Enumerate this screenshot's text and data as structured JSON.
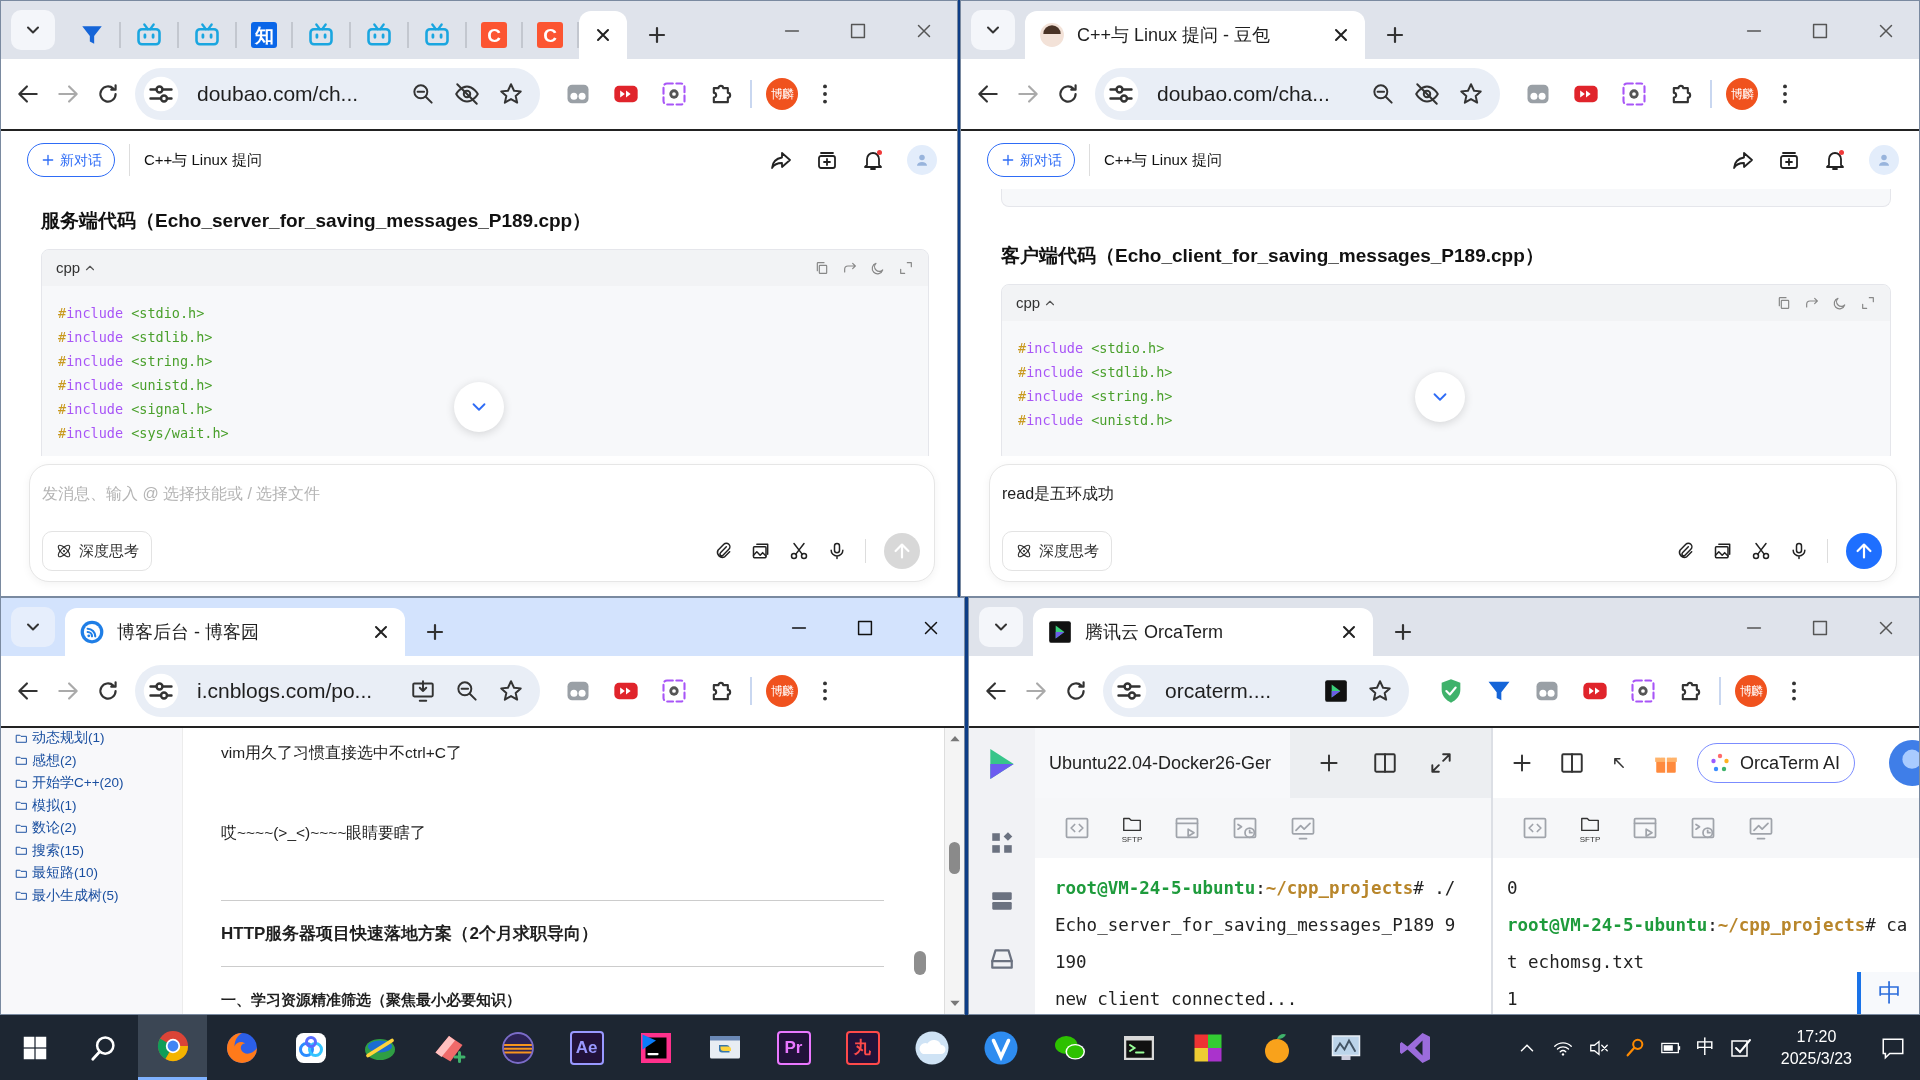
{
  "windows": [
    {
      "kind": "chat",
      "focused": false,
      "tabs": [
        {
          "kind": "funnel",
          "selected": false
        },
        {
          "kind": "tv",
          "selected": false
        },
        {
          "kind": "tv",
          "selected": false
        },
        {
          "kind": "glyph",
          "glyph": "知",
          "color": "#0a66e8",
          "selected": false
        },
        {
          "kind": "tv",
          "selected": false
        },
        {
          "kind": "tv",
          "selected": false
        },
        {
          "kind": "tv",
          "selected": false
        },
        {
          "kind": "glyph",
          "glyph": "C",
          "color": "#fc5531",
          "selected": false
        },
        {
          "kind": "glyph",
          "glyph": "C",
          "color": "#fc5531",
          "selected": false
        },
        {
          "kind": "blank",
          "selected": true
        }
      ],
      "url": "doubao.com/ch...",
      "profile": "博麟",
      "new_chat": "新对话",
      "conversation_title": "C++与 Linux 提问",
      "previous_block": false,
      "heading": "服务端代码（Echo_server_for_saving_messages_P189.cpp）",
      "code_language": "cpp",
      "code_lines": [
        {
          "directive": "#include",
          "header": "<stdio.h>"
        },
        {
          "directive": "#include",
          "header": "<stdlib.h>"
        },
        {
          "directive": "#include",
          "header": "<string.h>"
        },
        {
          "directive": "#include",
          "header": "<unistd.h>"
        },
        {
          "directive": "#include",
          "header": "<signal.h>"
        },
        {
          "directive": "#include",
          "header": "<sys/wait.h>"
        }
      ],
      "message_input": {
        "placeholder": "发消息、输入 @ 选择技能或 / 选择文件"
      },
      "deep_think": "深度思考",
      "send_enabled": false
    },
    {
      "kind": "chat",
      "focused": false,
      "tabs": [
        {
          "kind": "avatar",
          "title": "C++与 Linux 提问 - 豆包",
          "selected": true
        }
      ],
      "url": "doubao.com/cha...",
      "profile": "博麟",
      "new_chat": "新对话",
      "conversation_title": "C++与 Linux 提问",
      "previous_block": true,
      "heading": "客户端代码（Echo_client_for_saving_messages_P189.cpp）",
      "code_language": "cpp",
      "code_lines": [
        {
          "directive": "#include",
          "header": "<stdio.h>"
        },
        {
          "directive": "#include",
          "header": "<stdlib.h>"
        },
        {
          "directive": "#include",
          "header": "<string.h>"
        },
        {
          "directive": "#include",
          "header": "<unistd.h>"
        }
      ],
      "message_input": {
        "value": "read是五环成功"
      },
      "deep_think": "深度思考",
      "send_enabled": true
    },
    {
      "kind": "blog",
      "focused": true,
      "tabs": [
        {
          "kind": "feed",
          "title": "博客后台 - 博客园",
          "selected": true
        }
      ],
      "url": "i.cnblogs.com/po...",
      "profile": "博麟",
      "categories": [
        "动态规划(1)",
        "感想(2)",
        "开始学C++(20)",
        "模拟(1)",
        "数论(2)",
        "搜索(15)",
        "最短路(10)",
        "最小生成树(5)"
      ],
      "blocks": [
        {
          "kind": "text",
          "text": "vim用久了习惯直接选中不ctrl+C了"
        },
        {
          "kind": "text",
          "text": "哎~~~~(>_<)~~~~眼睛要瞎了"
        },
        {
          "kind": "rule"
        },
        {
          "kind": "heading",
          "text": "HTTP服务器项目快速落地方案（2个月求职导向）"
        },
        {
          "kind": "rule"
        },
        {
          "kind": "subheading",
          "text": "一、学习资源精准筛选（聚焦最小必要知识）"
        }
      ]
    },
    {
      "kind": "terminal",
      "focused": false,
      "tabs": [
        {
          "kind": "orcaterm",
          "title": "腾讯云 OrcaTerm",
          "selected": true
        }
      ],
      "url": "orcaterm....",
      "profile": "博麟",
      "panes": [
        {
          "title": "Ubuntu22.04-Docker26-Ger",
          "tools": [
            {
              "kind": "code"
            },
            {
              "kind": "sftp",
              "label": "SFTP"
            },
            {
              "kind": "window"
            },
            {
              "kind": "schedule"
            },
            {
              "kind": "monitor"
            }
          ],
          "lines": [
            {
              "segments": [
                {
                  "kind": "user",
                  "text": "root@VM-24-5-ubuntu"
                },
                {
                  "kind": "plain",
                  "text": ":"
                },
                {
                  "kind": "path",
                  "text": "~/cpp_projects"
                },
                {
                  "kind": "plain",
                  "text": "# ./"
                }
              ]
            },
            {
              "segments": [
                {
                  "kind": "plain",
                  "text": "Echo_server_for_saving_messages_P189 9"
                }
              ]
            },
            {
              "segments": [
                {
                  "kind": "plain",
                  "text": "190"
                }
              ]
            },
            {
              "segments": [
                {
                  "kind": "plain",
                  "text": "new client connected..."
                }
              ]
            }
          ]
        },
        {
          "ai_button": "OrcaTerm AI",
          "tools": [
            {
              "kind": "code"
            },
            {
              "kind": "sftp",
              "label": "SFTP"
            },
            {
              "kind": "window"
            },
            {
              "kind": "schedule"
            },
            {
              "kind": "monitor"
            }
          ],
          "lines": [
            {
              "segments": [
                {
                  "kind": "plain",
                  "text": "0"
                }
              ]
            },
            {
              "segments": [
                {
                  "kind": "user",
                  "text": "root@VM-24-5-ubuntu"
                },
                {
                  "kind": "plain",
                  "text": ":"
                },
                {
                  "kind": "path",
                  "text": "~/cpp_projects"
                },
                {
                  "kind": "plain",
                  "text": "# ca"
                }
              ]
            },
            {
              "segments": [
                {
                  "kind": "plain",
                  "text": "t echomsg.txt"
                }
              ]
            },
            {
              "segments": [
                {
                  "kind": "plain",
                  "text": "1"
                }
              ]
            }
          ]
        }
      ],
      "ime_indicator": "中"
    }
  ],
  "taskbar": {
    "apps": [
      {
        "kind": "start",
        "selected": false
      },
      {
        "kind": "search",
        "selected": false
      },
      {
        "kind": "chrome",
        "selected": true
      },
      {
        "kind": "firefox",
        "selected": false
      },
      {
        "kind": "netdisk",
        "selected": false
      },
      {
        "kind": "globe",
        "selected": false
      },
      {
        "kind": "eraser",
        "selected": false
      },
      {
        "kind": "eclipse",
        "selected": false
      },
      {
        "kind": "glyph",
        "glyph": "Ae",
        "color": "#9999ff",
        "selected": false
      },
      {
        "kind": "jetbrains",
        "selected": false
      },
      {
        "kind": "python",
        "selected": false
      },
      {
        "kind": "glyph",
        "glyph": "Pr",
        "color": "#ea77ff",
        "selected": false
      },
      {
        "kind": "glyph",
        "glyph": "丸",
        "color": "#ff4a4a",
        "selected": false
      },
      {
        "kind": "cloud",
        "selected": false
      },
      {
        "kind": "vcheck",
        "selected": false
      },
      {
        "kind": "wechat",
        "selected": false
      },
      {
        "kind": "console",
        "selected": false
      },
      {
        "kind": "tiles",
        "selected": false
      },
      {
        "kind": "orange",
        "selected": false
      },
      {
        "kind": "monitorapp",
        "selected": false
      },
      {
        "kind": "vs",
        "selected": false
      }
    ],
    "ime": "中",
    "time": "17:20",
    "date": "2025/3/23"
  }
}
